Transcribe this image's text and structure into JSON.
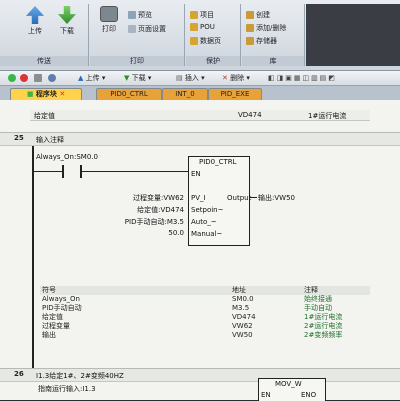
{
  "ribbon": {
    "transfer": {
      "upload": "上传",
      "download": "下载",
      "caption": "传送"
    },
    "print": {
      "print": "打印",
      "preview": "预览",
      "page_setup": "页面设置",
      "caption": "打印"
    },
    "protect": {
      "project": "项目",
      "pou": "POU",
      "data_page": "数据页",
      "caption": "保护"
    },
    "library": {
      "create": "创建",
      "add_remove": "添加/删除",
      "storage": "存储器",
      "caption": "库"
    }
  },
  "toolbar": {
    "upload": "上传",
    "download": "下载",
    "insert": "插入",
    "delete": "删除"
  },
  "tabs": [
    {
      "label": "程序块",
      "active": true
    },
    {
      "label": "PID0_CTRL",
      "active": false
    },
    {
      "label": "INT_0",
      "active": false
    },
    {
      "label": "PID_EXE",
      "active": false
    }
  ],
  "prev_row": {
    "name": "给定值",
    "addr": "VD474",
    "comment": "1#运行电流"
  },
  "network25": {
    "number": "25",
    "comment": "输入注释",
    "contact_label": "Always_On:SM0.0",
    "block_title": "PID0_CTRL",
    "en": "EN",
    "inputs": [
      {
        "source": "过程变量:VW62",
        "pin": "PV_I"
      },
      {
        "source": "给定值:VD474",
        "pin": "Setpoin~"
      },
      {
        "source": "PID手动自动:M3.5",
        "pin": "Auto_~"
      },
      {
        "source": "50.0",
        "pin": "Manual~"
      }
    ],
    "output_pin": "Output",
    "output_target": "输出:VW50",
    "symbol_table": {
      "headers": [
        "符号",
        "地址",
        "注释"
      ],
      "rows": [
        [
          "Always_On",
          "SM0.0",
          "始终接通"
        ],
        [
          "PID手动自动",
          "M3.5",
          "手动自动"
        ],
        [
          "给定值",
          "VD474",
          "1#运行电流"
        ],
        [
          "过程变量",
          "VW62",
          "2#运行电流"
        ],
        [
          "输出",
          "VW50",
          "2#变频频率"
        ]
      ]
    }
  },
  "network26": {
    "number": "26",
    "comment": "I1.3给定1#、2#变频40HZ",
    "contact_label": "指南运行输入:I1.3",
    "block_title": "MOV_W",
    "en": "EN",
    "eno": "ENO"
  },
  "colors": {
    "accent_green": "#3bb54a",
    "tab_active": "#ffd24a",
    "tab_inactive": "#e8a23a",
    "comment_green": "#1e6e2a"
  }
}
